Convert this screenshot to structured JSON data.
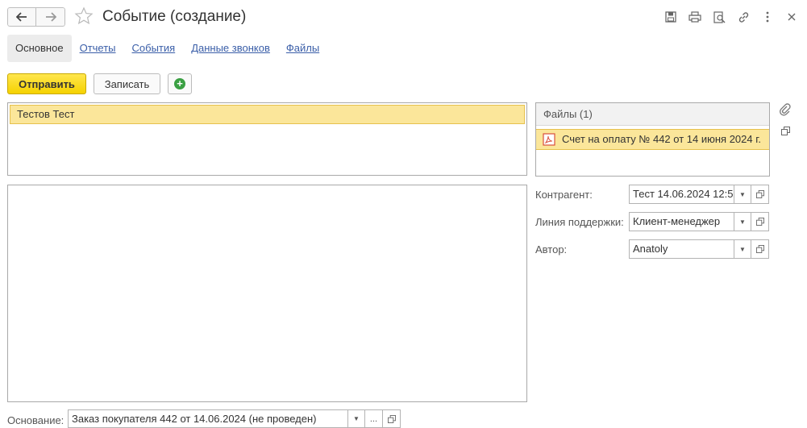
{
  "header": {
    "back_icon": "arrow-left-icon",
    "forward_icon": "arrow-right-icon",
    "favorite_icon": "star-icon",
    "title": "Событие (создание)",
    "icons": [
      "save-icon",
      "print-icon",
      "preview-icon",
      "link-icon",
      "more-icon",
      "close-icon"
    ]
  },
  "tabs": [
    {
      "label": "Основное",
      "active": true
    },
    {
      "label": "Отчеты",
      "active": false
    },
    {
      "label": "События",
      "active": false
    },
    {
      "label": "Данные звонков",
      "active": false
    },
    {
      "label": "Файлы",
      "active": false
    }
  ],
  "toolbar": {
    "send_label": "Отправить",
    "save_label": "Записать",
    "add_icon": "plus-circle-icon"
  },
  "recipients": {
    "selected": "Тестов Тест"
  },
  "files": {
    "header": "Файлы (1)",
    "items": [
      {
        "icon": "pdf-icon",
        "name": "Счет на оплату № 442 от 14 июня 2024 г."
      }
    ]
  },
  "side_icons": [
    "paperclip-icon",
    "open-window-icon"
  ],
  "fields": {
    "counterparty_label": "Контрагент:",
    "counterparty_value": "Тест 14.06.2024 12:5",
    "support_line_label": "Линия поддержки:",
    "support_line_value": "Клиент-менеджер",
    "author_label": "Автор:",
    "author_value": "Anatoly"
  },
  "basis": {
    "label": "Основание:",
    "value": "Заказ покупателя 442 от 14.06.2024 (не проведен)",
    "ellipsis": "..."
  },
  "colors": {
    "accent_yellow": "#f5d200",
    "selection": "#fbe69a",
    "link_blue": "#3a5ea8",
    "add_green": "#3aa043"
  }
}
